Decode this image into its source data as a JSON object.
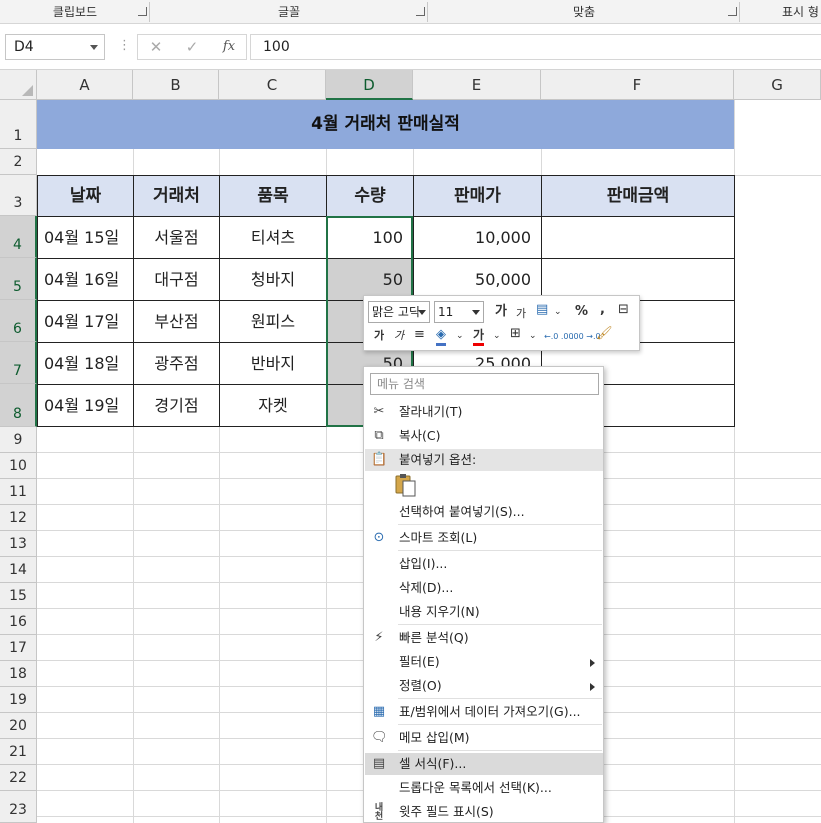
{
  "ribbon": {
    "groups": [
      "클립보드",
      "글꼴",
      "맞춤",
      "표시 형"
    ]
  },
  "formula_bar": {
    "name_box": "D4",
    "cancel": "✕",
    "enter": "✓",
    "fx": "fx",
    "value": "100"
  },
  "columns": [
    "A",
    "B",
    "C",
    "D",
    "E",
    "F",
    "G"
  ],
  "rows": [
    "1",
    "2",
    "3",
    "4",
    "5",
    "6",
    "7",
    "8",
    "9",
    "10",
    "11",
    "12",
    "13",
    "14",
    "15",
    "16",
    "17",
    "18",
    "19",
    "20",
    "21",
    "22",
    "23"
  ],
  "sheet": {
    "title": "4월 거래처 판매실적",
    "headers": [
      "날짜",
      "거래처",
      "품목",
      "수량",
      "판매가",
      "판매금액"
    ],
    "records": [
      [
        "04월 15일",
        "서울점",
        "티셔츠",
        "100",
        "10,000",
        ""
      ],
      [
        "04월 16일",
        "대구점",
        "청바지",
        "50",
        "50,000",
        ""
      ],
      [
        "04월 17일",
        "부산점",
        "원피스",
        "",
        "",
        ""
      ],
      [
        "04월 18일",
        "광주점",
        "반바지",
        "50",
        "25,000",
        ""
      ],
      [
        "04월 19일",
        "경기점",
        "자켓",
        "",
        "",
        ""
      ]
    ]
  },
  "mini_toolbar": {
    "font": "맑은 고딕",
    "size": "11",
    "percent": "%",
    "comma": ",",
    "grow": "가",
    "shrink": "가",
    "bold": "가",
    "italic": "가",
    "font_color": "가",
    "dec_inc": "←.0 .00",
    "dec_dec": ".00 →.0"
  },
  "context_menu": {
    "search_placeholder": "메뉴 검색",
    "cut": "잘라내기(T)",
    "copy": "복사(C)",
    "paste_options": "붙여넣기 옵션:",
    "paste_special": "선택하여 붙여넣기(S)...",
    "smart_lookup": "스마트 조회(L)",
    "insert": "삽입(I)...",
    "delete": "삭제(D)...",
    "clear": "내용 지우기(N)",
    "quick_analysis": "빠른 분석(Q)",
    "filter": "필터(E)",
    "sort": "정렬(O)",
    "get_data": "표/범위에서 데이터 가져오기(G)...",
    "insert_comment": "메모 삽입(M)",
    "format_cells": "셀 서식(F)...",
    "pick_dropdown": "드롭다운 목록에서 선택(K)...",
    "phonetic": "윗주 필드 표시(S)",
    "phonetic_icon": "내천"
  }
}
